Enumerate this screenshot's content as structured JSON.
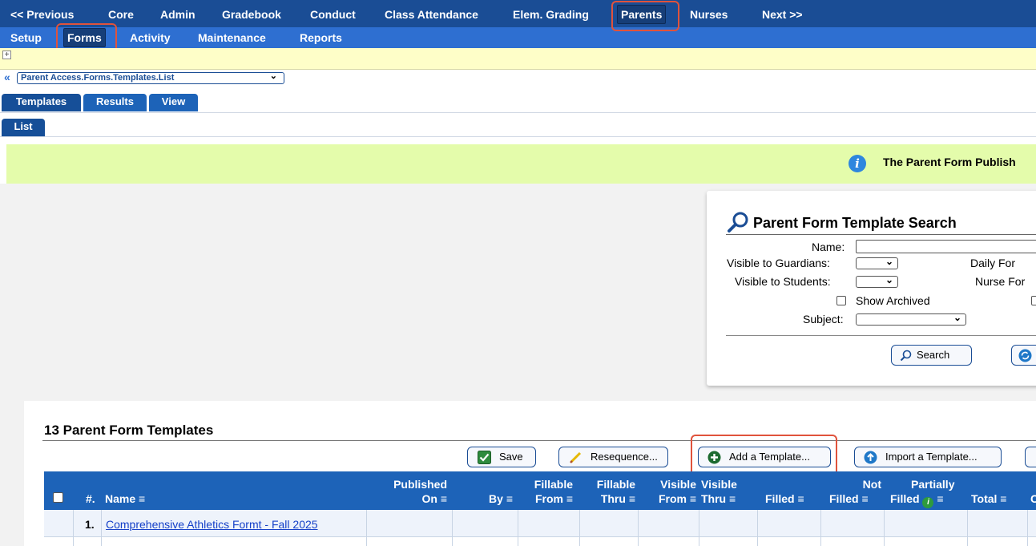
{
  "nav_primary": [
    "<< Previous",
    "Core",
    "Admin",
    "Gradebook",
    "Conduct",
    "Class Attendance",
    "Elem. Grading",
    "Parents",
    "Nurses",
    "Next >>"
  ],
  "nav_secondary": [
    "Setup",
    "Forms",
    "Activity",
    "Maintenance",
    "Reports"
  ],
  "breadcrumb": {
    "back": "«",
    "path": "Parent Access.Forms.Templates.List"
  },
  "tabs": [
    "Templates",
    "Results",
    "View"
  ],
  "subtabs": [
    "List"
  ],
  "info_banner": "The Parent Form Publish",
  "search": {
    "title": "Parent Form Template Search",
    "name_label": "Name:",
    "visible_guardians_label": "Visible to Guardians:",
    "visible_students_label": "Visible to Students:",
    "show_archived_label": "Show Archived",
    "subject_label": "Subject:",
    "daily_form_label": "Daily For",
    "nurse_form_label": "Nurse For",
    "search_button": "Search"
  },
  "results": {
    "title": "13 Parent Form Templates",
    "buttons": {
      "save": "Save",
      "resequence": "Resequence...",
      "add_template": "Add a Template...",
      "import_template": "Import a Template..."
    },
    "columns": {
      "num": "#.",
      "name": "Name",
      "published_1": "Published",
      "published_2": "On",
      "by": "By",
      "fillable_from_1": "Fillable",
      "fillable_from_2": "From",
      "fillable_thru_1": "Fillable",
      "fillable_thru_2": "Thru",
      "visible_from_1": "Visible",
      "visible_from_2": "From",
      "visible_thru_1": "Visible",
      "visible_thru_2": "Thru",
      "filled": "Filled",
      "not_filled_1": "Not",
      "not_filled_2": "Filled",
      "partially_1": "Partially",
      "partially_2": "Filled",
      "total": "Total",
      "menu_glyph": "≡",
      "cut": "C"
    },
    "rows": [
      {
        "num": "1.",
        "name": "Comprehensive Athletics Formt - Fall 2025"
      }
    ]
  },
  "colors": {
    "nav_primary_bg": "#1a4d95",
    "nav_secondary_bg": "#2e6fd1",
    "highlight": "#e0533c",
    "banner_bg": "#e4fcab"
  }
}
